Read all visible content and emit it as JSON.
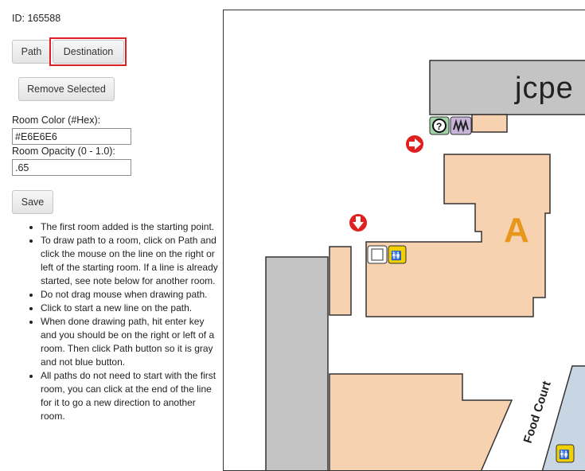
{
  "record": {
    "id_label": "ID: 165588"
  },
  "toolbar": {
    "path_label": "Path",
    "destination_label": "Destination",
    "remove_label": "Remove Selected",
    "save_label": "Save"
  },
  "form": {
    "room_color_label": "Room Color (#Hex):",
    "room_color_value": "#E6E6E6",
    "room_opacity_label": "Room Opacity (0 - 1.0):",
    "room_opacity_value": ".65"
  },
  "instructions": [
    "The first room added is the starting point.",
    "To draw path to a room, click on Path and click the mouse on the line on the right or left of the starting room. If a line is already started, see note below for another room.",
    "Do not drag mouse when drawing path.",
    "Click to start a new line on the path.",
    "When done drawing path, hit enter key and you should be on the right or left of a room. Then click Path button so it is gray and not blue button.",
    "All paths do not need to start with the first room, you can click at the end of the line for it to go a new direction to another room."
  ],
  "map": {
    "anchor_store_label": "jcpe",
    "room_letter": "A",
    "food_court_label": "Food Court",
    "colors": {
      "room_fill": "#f6d2b0",
      "anchor_fill": "#c4c4c4",
      "letter": "#e8961c",
      "arrow": "#e02020",
      "restroom_icon": "#f2d000",
      "walkway": "#c8d6e4"
    },
    "icons": [
      "info-icon",
      "mailbox-icon",
      "arrow-right-icon",
      "arrow-down-icon",
      "restroom-icon",
      "elevator-icon"
    ]
  }
}
